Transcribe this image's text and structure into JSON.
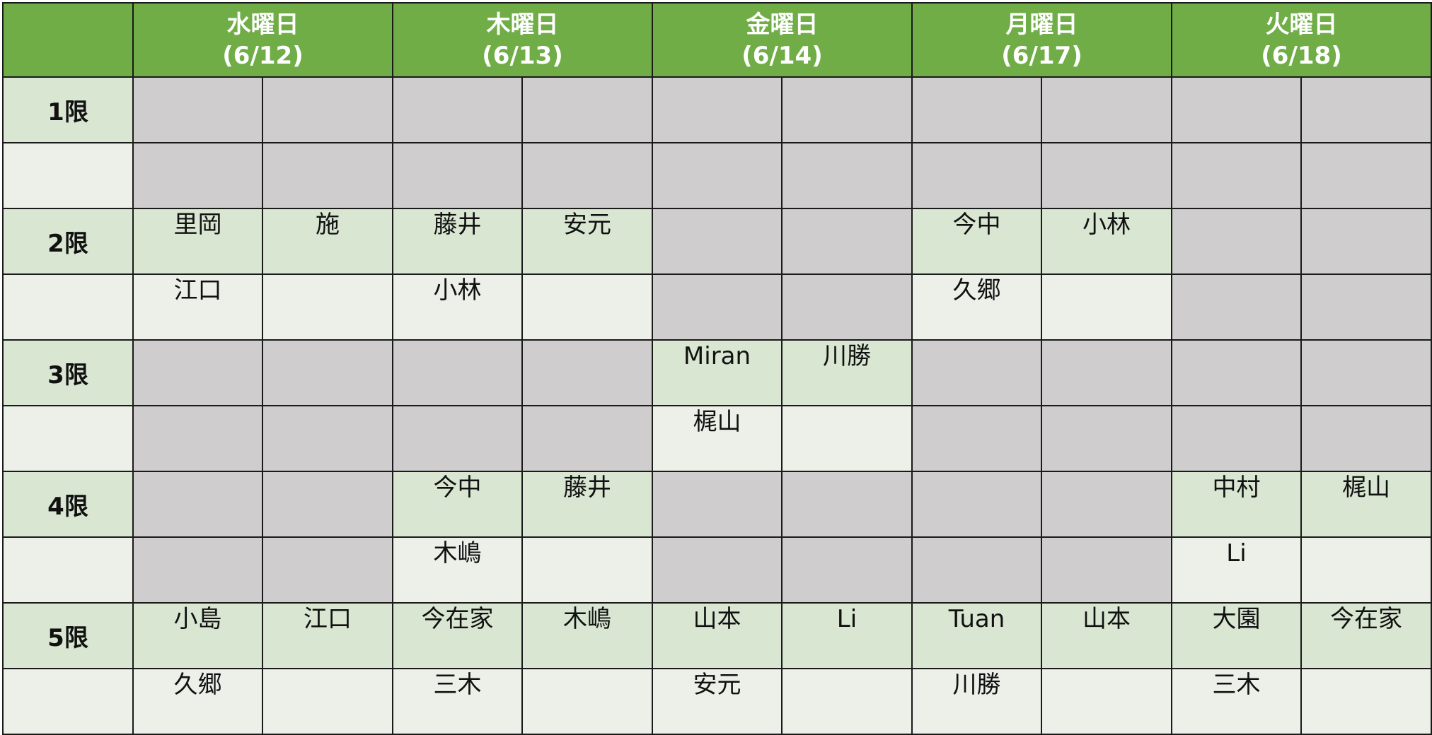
{
  "days": [
    {
      "name": "水曜日",
      "date": "(6/12)"
    },
    {
      "name": "木曜日",
      "date": "(6/13)"
    },
    {
      "name": "金曜日",
      "date": "(6/14)"
    },
    {
      "name": "月曜日",
      "date": "(6/17)"
    },
    {
      "name": "火曜日",
      "date": "(6/18)"
    }
  ],
  "periods": [
    {
      "label": "1限",
      "rowA": [
        {
          "t": "",
          "g": 1
        },
        {
          "t": "",
          "g": 1
        },
        {
          "t": "",
          "g": 1
        },
        {
          "t": "",
          "g": 1
        },
        {
          "t": "",
          "g": 1
        },
        {
          "t": "",
          "g": 1
        },
        {
          "t": "",
          "g": 1
        },
        {
          "t": "",
          "g": 1
        },
        {
          "t": "",
          "g": 1
        },
        {
          "t": "",
          "g": 1
        }
      ],
      "rowB": [
        {
          "t": "",
          "g": 1
        },
        {
          "t": "",
          "g": 1
        },
        {
          "t": "",
          "g": 1
        },
        {
          "t": "",
          "g": 1
        },
        {
          "t": "",
          "g": 1
        },
        {
          "t": "",
          "g": 1
        },
        {
          "t": "",
          "g": 1
        },
        {
          "t": "",
          "g": 1
        },
        {
          "t": "",
          "g": 1
        },
        {
          "t": "",
          "g": 1
        }
      ]
    },
    {
      "label": "2限",
      "rowA": [
        {
          "t": "里岡",
          "g": 0
        },
        {
          "t": "施",
          "g": 0
        },
        {
          "t": "藤井",
          "g": 0
        },
        {
          "t": "安元",
          "g": 0
        },
        {
          "t": "",
          "g": 1
        },
        {
          "t": "",
          "g": 1
        },
        {
          "t": "今中",
          "g": 0
        },
        {
          "t": "小林",
          "g": 0
        },
        {
          "t": "",
          "g": 1
        },
        {
          "t": "",
          "g": 1
        }
      ],
      "rowB": [
        {
          "t": "江口",
          "g": 0
        },
        {
          "t": "",
          "g": 0
        },
        {
          "t": "小林",
          "g": 0
        },
        {
          "t": "",
          "g": 0
        },
        {
          "t": "",
          "g": 1
        },
        {
          "t": "",
          "g": 1
        },
        {
          "t": "久郷",
          "g": 0
        },
        {
          "t": "",
          "g": 0
        },
        {
          "t": "",
          "g": 1
        },
        {
          "t": "",
          "g": 1
        }
      ]
    },
    {
      "label": "3限",
      "rowA": [
        {
          "t": "",
          "g": 1
        },
        {
          "t": "",
          "g": 1
        },
        {
          "t": "",
          "g": 1
        },
        {
          "t": "",
          "g": 1
        },
        {
          "t": "Miran",
          "g": 0
        },
        {
          "t": "川勝",
          "g": 0
        },
        {
          "t": "",
          "g": 1
        },
        {
          "t": "",
          "g": 1
        },
        {
          "t": "",
          "g": 1
        },
        {
          "t": "",
          "g": 1
        }
      ],
      "rowB": [
        {
          "t": "",
          "g": 1
        },
        {
          "t": "",
          "g": 1
        },
        {
          "t": "",
          "g": 1
        },
        {
          "t": "",
          "g": 1
        },
        {
          "t": "梶山",
          "g": 0
        },
        {
          "t": "",
          "g": 0
        },
        {
          "t": "",
          "g": 1
        },
        {
          "t": "",
          "g": 1
        },
        {
          "t": "",
          "g": 1
        },
        {
          "t": "",
          "g": 1
        }
      ]
    },
    {
      "label": "4限",
      "rowA": [
        {
          "t": "",
          "g": 1
        },
        {
          "t": "",
          "g": 1
        },
        {
          "t": "今中",
          "g": 0
        },
        {
          "t": "藤井",
          "g": 0
        },
        {
          "t": "",
          "g": 1
        },
        {
          "t": "",
          "g": 1
        },
        {
          "t": "",
          "g": 1
        },
        {
          "t": "",
          "g": 1
        },
        {
          "t": "中村",
          "g": 0
        },
        {
          "t": "梶山",
          "g": 0
        }
      ],
      "rowB": [
        {
          "t": "",
          "g": 1
        },
        {
          "t": "",
          "g": 1
        },
        {
          "t": "木嶋",
          "g": 0
        },
        {
          "t": "",
          "g": 0
        },
        {
          "t": "",
          "g": 1
        },
        {
          "t": "",
          "g": 1
        },
        {
          "t": "",
          "g": 1
        },
        {
          "t": "",
          "g": 1
        },
        {
          "t": "Li",
          "g": 0
        },
        {
          "t": "",
          "g": 0
        }
      ]
    },
    {
      "label": "5限",
      "rowA": [
        {
          "t": "小島",
          "g": 0
        },
        {
          "t": "江口",
          "g": 0
        },
        {
          "t": "今在家",
          "g": 0
        },
        {
          "t": "木嶋",
          "g": 0
        },
        {
          "t": "山本",
          "g": 0
        },
        {
          "t": "Li",
          "g": 0
        },
        {
          "t": "Tuan",
          "g": 0
        },
        {
          "t": "山本",
          "g": 0
        },
        {
          "t": "大園",
          "g": 0
        },
        {
          "t": "今在家",
          "g": 0
        }
      ],
      "rowB": [
        {
          "t": "久郷",
          "g": 0
        },
        {
          "t": "",
          "g": 0
        },
        {
          "t": "三木",
          "g": 0
        },
        {
          "t": "",
          "g": 0
        },
        {
          "t": "安元",
          "g": 0
        },
        {
          "t": "",
          "g": 0
        },
        {
          "t": "川勝",
          "g": 0
        },
        {
          "t": "",
          "g": 0
        },
        {
          "t": "三木",
          "g": 0
        },
        {
          "t": "",
          "g": 0
        }
      ]
    }
  ]
}
